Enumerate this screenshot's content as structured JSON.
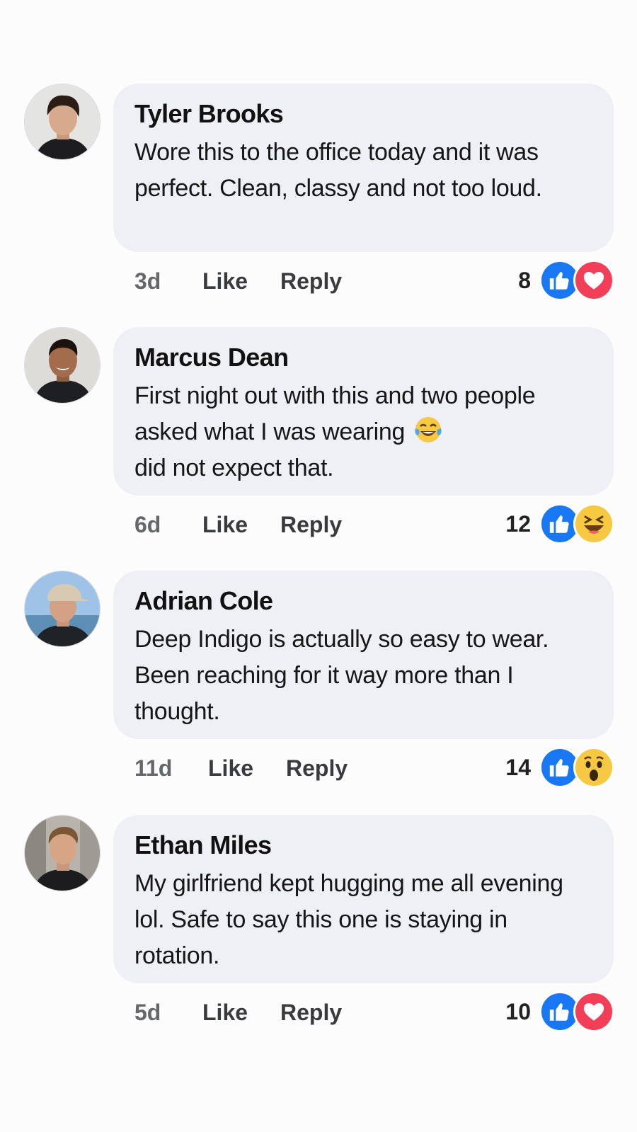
{
  "comments": [
    {
      "author": "Tyler Brooks",
      "text": "Wore this to the office today and it was perfect. Clean, classy and not too loud.",
      "time": "3d",
      "like_label": "Like",
      "reply_label": "Reply",
      "reaction_count": "8",
      "reactions": [
        "like-icon",
        "love-icon"
      ]
    },
    {
      "author": "Marcus Dean",
      "text": "First night out with this and two people asked what I was wearing",
      "text_after": "did not expect that.",
      "inline_emoji": "tears-of-joy-emoji",
      "time": "6d",
      "like_label": "Like",
      "reply_label": "Reply",
      "reaction_count": "12",
      "reactions": [
        "like-icon",
        "haha-icon"
      ]
    },
    {
      "author": "Adrian Cole",
      "text": "Deep Indigo is actually so easy to wear. Been reaching for it way more than I thought.",
      "time": "11d",
      "like_label": "Like",
      "reply_label": "Reply",
      "reaction_count": "14",
      "reactions": [
        "like-icon",
        "wow-icon"
      ]
    },
    {
      "author": "Ethan Miles",
      "text": "My girlfriend kept hugging me all evening lol. Safe to say this one is staying in rotation.",
      "time": "5d",
      "like_label": "Like",
      "reply_label": "Reply",
      "reaction_count": "10",
      "reactions": [
        "like-icon",
        "love-icon"
      ]
    }
  ],
  "colors": {
    "bubble": "#eef0f5",
    "like_reaction": "#1877f2",
    "love_reaction": "#f33e58",
    "emoji_yellow": "#f7c841",
    "meta_text": "#65676b"
  }
}
